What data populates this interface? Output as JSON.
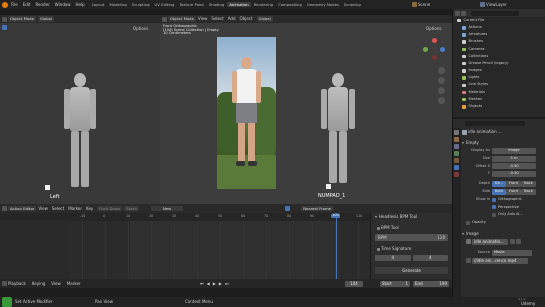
{
  "menu": {
    "file": "File",
    "edit": "Edit",
    "render": "Render",
    "window": "Window",
    "help": "Help",
    "workspaces": [
      "Layout",
      "Modeling",
      "Sculpting",
      "UV Editing",
      "Texture Paint",
      "Shading",
      "Animation",
      "Rendering",
      "Compositing",
      "Geometry Nodes",
      "Scripting"
    ],
    "active_workspace": "Animation",
    "scene": "Scene",
    "view_layer": "ViewLayer"
  },
  "left_vp": {
    "mode": "Object Mode",
    "orientation": "Global",
    "options": "Options",
    "label": "Left"
  },
  "center_vp": {
    "mode": "Object Mode",
    "orientation": "Global",
    "menu": [
      "View",
      "Select",
      "Add",
      "Object"
    ],
    "options": "Options",
    "info": [
      "Front Orthographic",
      "(104) Scene Collection | Empty",
      "10 Centimeters"
    ]
  },
  "right_vp": {
    "label": "NUMPAD_1"
  },
  "outliner": {
    "title": "Current File",
    "items": [
      {
        "label": "Actions",
        "color": "#7aa6d8"
      },
      {
        "label": "Armatures",
        "color": "#7aa6d8"
      },
      {
        "label": "Brushes",
        "color": "#cfcfcf"
      },
      {
        "label": "Cameras",
        "color": "#9bc25b"
      },
      {
        "label": "Collections",
        "color": "#cfcfcf"
      },
      {
        "label": "Grease Pencil (legacy)",
        "color": "#cfcfcf"
      },
      {
        "label": "Images",
        "color": "#cfcfcf"
      },
      {
        "label": "Lights",
        "color": "#9bc25b"
      },
      {
        "label": "Line Styles",
        "color": "#cfcfcf"
      },
      {
        "label": "Materials",
        "color": "#d67a7a"
      },
      {
        "label": "Meshes",
        "color": "#9bc25b"
      },
      {
        "label": "Objects",
        "color": "#e8a23d"
      }
    ]
  },
  "properties": {
    "object_name": "idle animation ...",
    "section": "Empty",
    "display_as_label": "Display As",
    "display_as": "Image",
    "size_label": "Size",
    "size": "5 m",
    "offset_x_label": "Offset X",
    "offset_x": "-0.50",
    "offset_y_label": "Y",
    "offset_y": "-0.50",
    "depth_label": "Depth",
    "depth_options": [
      "De...",
      "Front",
      "Back"
    ],
    "side_label": "Side",
    "side_options": [
      "Both",
      "Front",
      "Back"
    ],
    "show_in_label": "Show In",
    "show_in": [
      "Orthographic",
      "Perspective",
      "Only Axis Al..."
    ],
    "opacity_label": "Opacity",
    "image_section": "Image",
    "image_name": "idle animatio...",
    "source_label": "Source",
    "source": "Movie",
    "filepath": "//idle ani...rence.mp4"
  },
  "dopesheet": {
    "editor": "Action Editor",
    "menu": [
      "View",
      "Select",
      "Marker",
      "Key"
    ],
    "push_down": "Push Down",
    "stash": "Stash",
    "new": "New",
    "ticks": [
      "-10",
      "0",
      "10",
      "20",
      "30",
      "40",
      "50",
      "60",
      "70",
      "80",
      "90",
      "100",
      "110"
    ],
    "current_frame": "104"
  },
  "n_panel": {
    "snap": "Nearest Frame",
    "tool_title": "Headlesis BPM Tool",
    "bpm_tool": "BPM Tool",
    "bpm_label": "BPM",
    "bpm_value": "128",
    "time_sig_label": "Time Signature",
    "time_sig_a": "4",
    "time_sig_b": "4",
    "generate": "Generate"
  },
  "playback": {
    "playback": "Playback",
    "keying": "Keying",
    "view": "View",
    "marker": "Marker",
    "frame": "104",
    "start_label": "Start",
    "start": "1",
    "end_label": "End",
    "end": "190"
  },
  "status": {
    "left": "Set Active Modifier",
    "mid": "Pan View",
    "right": "Context Menu",
    "version": "4.1.1",
    "brand": "Udemy"
  },
  "colors": {
    "accent": "#4772b3",
    "active_frame": "#4772b3",
    "blender_orange": "#e87d0d"
  }
}
